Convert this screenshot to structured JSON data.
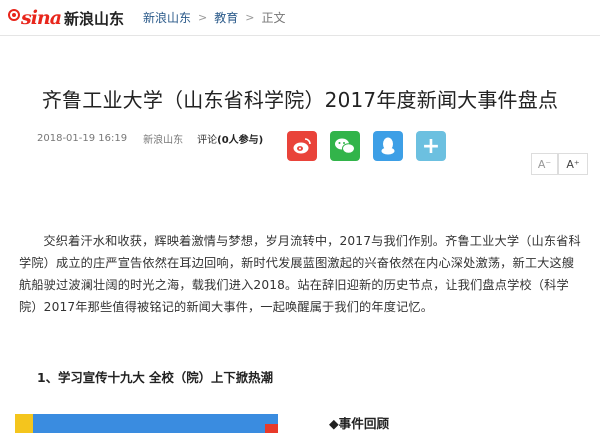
{
  "header": {
    "logo_brand": "sina",
    "logo_site": "新浪山东",
    "breadcrumb": [
      {
        "label": "新浪山东"
      },
      {
        "label": "教育"
      },
      {
        "label": "正文"
      }
    ],
    "separator": ">"
  },
  "article": {
    "title": "齐鲁工业大学（山东省科学院）2017年度新闻大事件盘点",
    "date": "2018-01-19 16:19",
    "source": "新浪山东",
    "comment_label": "评论",
    "comment_count": "(0人参与)",
    "paragraph": "交织着汗水和收获，辉映着激情与梦想，岁月流转中，2017与我们作别。齐鲁工业大学（山东省科学院）成立的庄严宣告依然在耳边回响，新时代发展蓝图激起的兴奋依然在内心深处激荡，新工大这艘航船驶过波澜壮阔的时光之海，载我们进入2018。站在辞旧迎新的历史节点，让我们盘点学校（科学院）2017年那些值得被铭记的新闻大事件，一起唤醒属于我们的年度记忆。",
    "section_heading": "1、学习宣传十九大 全校（院）上下掀热潮",
    "event_heading": "◆事件回顾"
  },
  "share": {
    "weibo_icon": "weibo-icon",
    "wechat_icon": "wechat-icon",
    "qq_icon": "qq-icon",
    "more_icon": "plus-icon"
  },
  "font_controls": {
    "smaller": "A⁻",
    "larger": "A⁺"
  },
  "colors": {
    "brand_red": "#e8261c",
    "link_blue": "#2b5a8a",
    "weibo": "#e9433a",
    "wechat": "#32b44a",
    "qq": "#3d9fe6",
    "more": "#6cc0e0"
  }
}
